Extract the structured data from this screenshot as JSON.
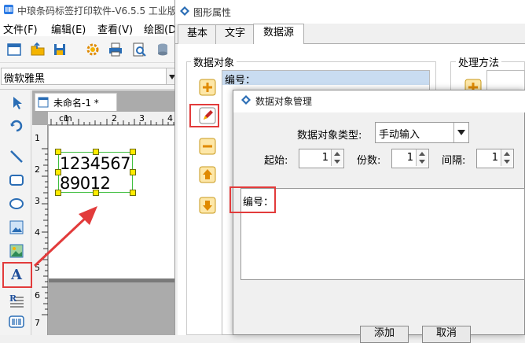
{
  "app": {
    "title": "中琅条码标签打印软件-V6.5.5 工业版",
    "menu": [
      "文件(F)",
      "编辑(E)",
      "查看(V)",
      "绘图(D"
    ],
    "font_name": "微软雅黑",
    "document_tab": "未命名-1 *",
    "ruler_unit": "cm",
    "ruler_marks_top": [
      "1",
      "2",
      "3",
      "4"
    ],
    "ruler_marks_left": [
      "1",
      "2",
      "3",
      "4",
      "5",
      "6",
      "7"
    ],
    "text_object": {
      "line1": "1234567",
      "line2": "89012"
    },
    "text_tool_label": "A"
  },
  "props_dialog": {
    "title": "图形属性",
    "tabs": [
      "基本",
      "文字",
      "数据源"
    ],
    "active_tab": "数据源",
    "group_data_label": "数据对象",
    "group_proc_label": "处理方法",
    "data_list": [
      "编号："
    ]
  },
  "dom_dialog": {
    "title": "数据对象管理",
    "type_label": "数据对象类型:",
    "type_value": "手动输入",
    "start_label": "起始:",
    "start_value": "1",
    "copies_label": "份数:",
    "copies_value": "1",
    "interval_label": "间隔:",
    "interval_value": "1",
    "content": "编号：",
    "ok_label": "添加",
    "cancel_label": "取消"
  },
  "colors": {
    "highlight": "#e23b3b",
    "selection_green": "#3fbf3f",
    "handle_yellow": "#ffeb00",
    "list_selected": "#c9dcf1"
  }
}
